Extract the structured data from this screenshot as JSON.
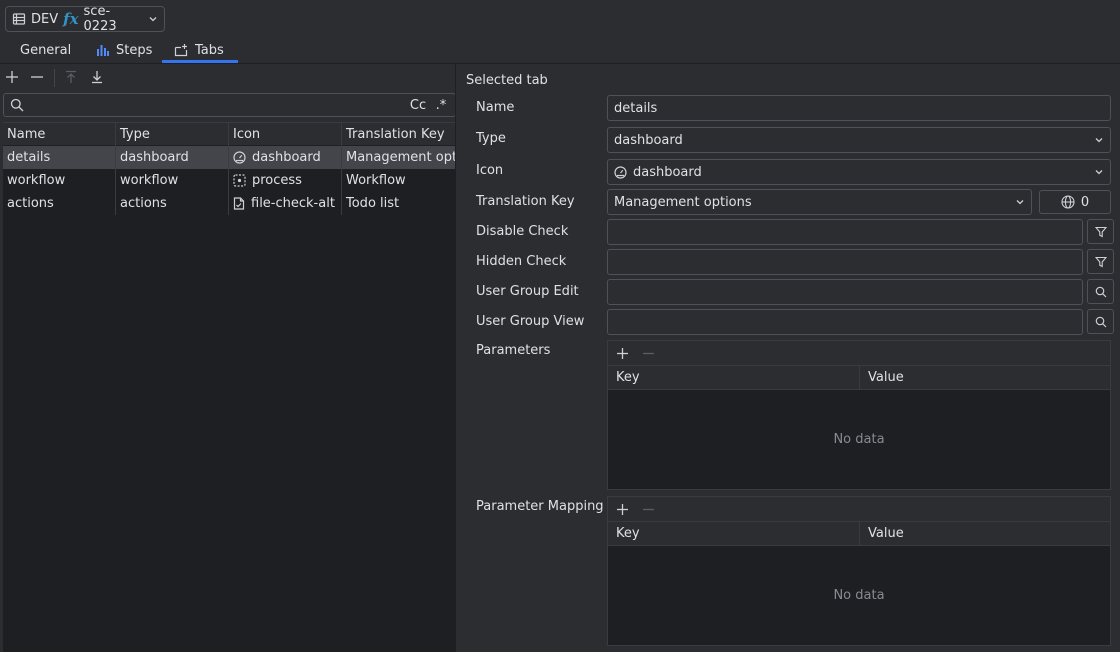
{
  "selector": {
    "env": "DEV",
    "fx": "fx",
    "name": "sce-0223"
  },
  "tabs": [
    {
      "label": "General"
    },
    {
      "label": "Steps"
    },
    {
      "label": "Tabs"
    }
  ],
  "search": {
    "value": "",
    "placeholder": "",
    "case_toggle": "Cc",
    "regex_toggle": ".*"
  },
  "tab_list": {
    "columns": [
      "Name",
      "Type",
      "Icon",
      "Translation Key"
    ],
    "rows": [
      {
        "name": "details",
        "type": "dashboard",
        "icon": "dashboard",
        "translation_key": "Management opt",
        "selected": true
      },
      {
        "name": "workflow",
        "type": "workflow",
        "icon": "process",
        "translation_key": "Workflow",
        "selected": false
      },
      {
        "name": "actions",
        "type": "actions",
        "icon": "file-check-alt",
        "translation_key": "Todo list",
        "selected": false
      }
    ]
  },
  "form": {
    "section_title": "Selected tab",
    "name": {
      "label": "Name",
      "value": "details"
    },
    "type": {
      "label": "Type",
      "value": "dashboard"
    },
    "icon": {
      "label": "Icon",
      "value": "dashboard"
    },
    "translation_key": {
      "label": "Translation Key",
      "value": "Management options",
      "count": "0"
    },
    "disable_check": {
      "label": "Disable Check",
      "value": ""
    },
    "hidden_check": {
      "label": "Hidden Check",
      "value": ""
    },
    "user_group_edit": {
      "label": "User Group Edit",
      "value": ""
    },
    "user_group_view": {
      "label": "User Group View",
      "value": ""
    },
    "parameters": {
      "label": "Parameters",
      "key_header": "Key",
      "value_header": "Value",
      "empty_text": "No data"
    },
    "parameter_mapping": {
      "label": "Parameter Mapping",
      "key_header": "Key",
      "value_header": "Value",
      "empty_text": "No data"
    }
  },
  "colors": {
    "background": "#2b2d30",
    "panel_dark": "#1e1f22",
    "accent": "#3574f0",
    "fx_blue": "#3592c4",
    "selected_row": "#43454a"
  }
}
